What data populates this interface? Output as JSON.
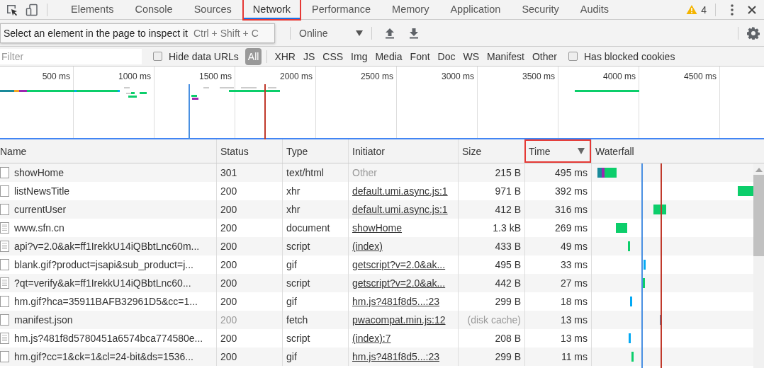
{
  "tabs": [
    {
      "label": "Elements",
      "selected": false,
      "highlighted": false
    },
    {
      "label": "Console",
      "selected": false,
      "highlighted": false
    },
    {
      "label": "Sources",
      "selected": false,
      "highlighted": false
    },
    {
      "label": "Network",
      "selected": true,
      "highlighted": true
    },
    {
      "label": "Performance",
      "selected": false,
      "highlighted": false
    },
    {
      "label": "Memory",
      "selected": false,
      "highlighted": false
    },
    {
      "label": "Application",
      "selected": false,
      "highlighted": false
    },
    {
      "label": "Security",
      "selected": false,
      "highlighted": false
    },
    {
      "label": "Audits",
      "selected": false,
      "highlighted": false
    }
  ],
  "warning_count": "4",
  "tooltip": {
    "text": "Select an element in the page to inspect it",
    "shortcut": "Ctrl + Shift + C"
  },
  "throttling": {
    "value": "Online"
  },
  "filter": {
    "placeholder": "Filter",
    "hide_data_urls": {
      "label": "Hide data URLs",
      "checked": false
    },
    "types": [
      {
        "label": "All",
        "selected": true
      },
      {
        "label": "XHR",
        "selected": false
      },
      {
        "label": "JS",
        "selected": false
      },
      {
        "label": "CSS",
        "selected": false
      },
      {
        "label": "Img",
        "selected": false
      },
      {
        "label": "Media",
        "selected": false
      },
      {
        "label": "Font",
        "selected": false
      },
      {
        "label": "Doc",
        "selected": false
      },
      {
        "label": "WS",
        "selected": false
      },
      {
        "label": "Manifest",
        "selected": false
      },
      {
        "label": "Other",
        "selected": false
      }
    ],
    "blocked_cookies": {
      "label": "Has blocked cookies",
      "checked": false
    }
  },
  "overview": {
    "ticks": [
      "500 ms",
      "1000 ms",
      "1500 ms",
      "2000 ms",
      "2500 ms",
      "3000 ms",
      "3500 ms",
      "4000 ms",
      "4500 ms"
    ]
  },
  "table": {
    "columns": [
      {
        "label": "Name",
        "highlighted": false,
        "sorted": false
      },
      {
        "label": "Status",
        "highlighted": false,
        "sorted": false
      },
      {
        "label": "Type",
        "highlighted": false,
        "sorted": false
      },
      {
        "label": "Initiator",
        "highlighted": false,
        "sorted": false
      },
      {
        "label": "Size",
        "highlighted": false,
        "sorted": false
      },
      {
        "label": "Time",
        "highlighted": true,
        "sorted": true
      },
      {
        "label": "Waterfall",
        "highlighted": false,
        "sorted": false
      }
    ],
    "rows": [
      {
        "kind": "file",
        "name": "showHome",
        "status": "301",
        "type": "text/html",
        "initiator": "Other",
        "initiator_link": false,
        "size": "215 B",
        "from_cache": false,
        "time": "495 ms"
      },
      {
        "kind": "file",
        "name": "listNewsTitle",
        "status": "200",
        "type": "xhr",
        "initiator": "default.umi.async.js:1",
        "initiator_link": true,
        "size": "971 B",
        "from_cache": false,
        "time": "392 ms"
      },
      {
        "kind": "file",
        "name": "currentUser",
        "status": "200",
        "type": "xhr",
        "initiator": "default.umi.async.js:1",
        "initiator_link": true,
        "size": "412 B",
        "from_cache": false,
        "time": "316 ms"
      },
      {
        "kind": "document",
        "name": "www.sfn.cn",
        "status": "200",
        "type": "document",
        "initiator": "showHome",
        "initiator_link": true,
        "size": "1.3 kB",
        "from_cache": false,
        "time": "269 ms"
      },
      {
        "kind": "document",
        "name": "api?v=2.0&ak=ff1IrekkU14iQBbtLnc60m...",
        "status": "200",
        "type": "script",
        "initiator": "(index)",
        "initiator_link": true,
        "size": "433 B",
        "from_cache": false,
        "time": "49 ms"
      },
      {
        "kind": "file",
        "name": "blank.gif?product=jsapi&sub_product=j...",
        "status": "200",
        "type": "gif",
        "initiator": "getscript?v=2.0&ak...",
        "initiator_link": true,
        "size": "495 B",
        "from_cache": false,
        "time": "33 ms"
      },
      {
        "kind": "document",
        "name": "?qt=verify&ak=ff1IrekkU14iQBbtLnc60...",
        "status": "200",
        "type": "script",
        "initiator": "getscript?v=2.0&ak...",
        "initiator_link": true,
        "size": "442 B",
        "from_cache": false,
        "time": "27 ms"
      },
      {
        "kind": "file",
        "name": "hm.gif?hca=35911BAFB32961D5&cc=1...",
        "status": "200",
        "type": "gif",
        "initiator": "hm.js?481f8d5...:23",
        "initiator_link": true,
        "size": "299 B",
        "from_cache": false,
        "time": "18 ms"
      },
      {
        "kind": "file",
        "name": "manifest.json",
        "status": "200",
        "type": "fetch",
        "initiator": "pwacompat.min.js:12",
        "initiator_link": true,
        "size": "(disk cache)",
        "from_cache": true,
        "time": "13 ms"
      },
      {
        "kind": "document",
        "name": "hm.js?481f8d5780451a6574bca774580e...",
        "status": "200",
        "type": "script",
        "initiator": "(index):7",
        "initiator_link": true,
        "size": "208 B",
        "from_cache": false,
        "time": "13 ms"
      },
      {
        "kind": "file",
        "name": "hm.gif?cc=1&ck=1&cl=24-bit&ds=1536...",
        "status": "200",
        "type": "gif",
        "initiator": "hm.js?481f8d5...:23",
        "initiator_link": true,
        "size": "299 B",
        "from_cache": false,
        "time": "11 ms"
      }
    ]
  }
}
